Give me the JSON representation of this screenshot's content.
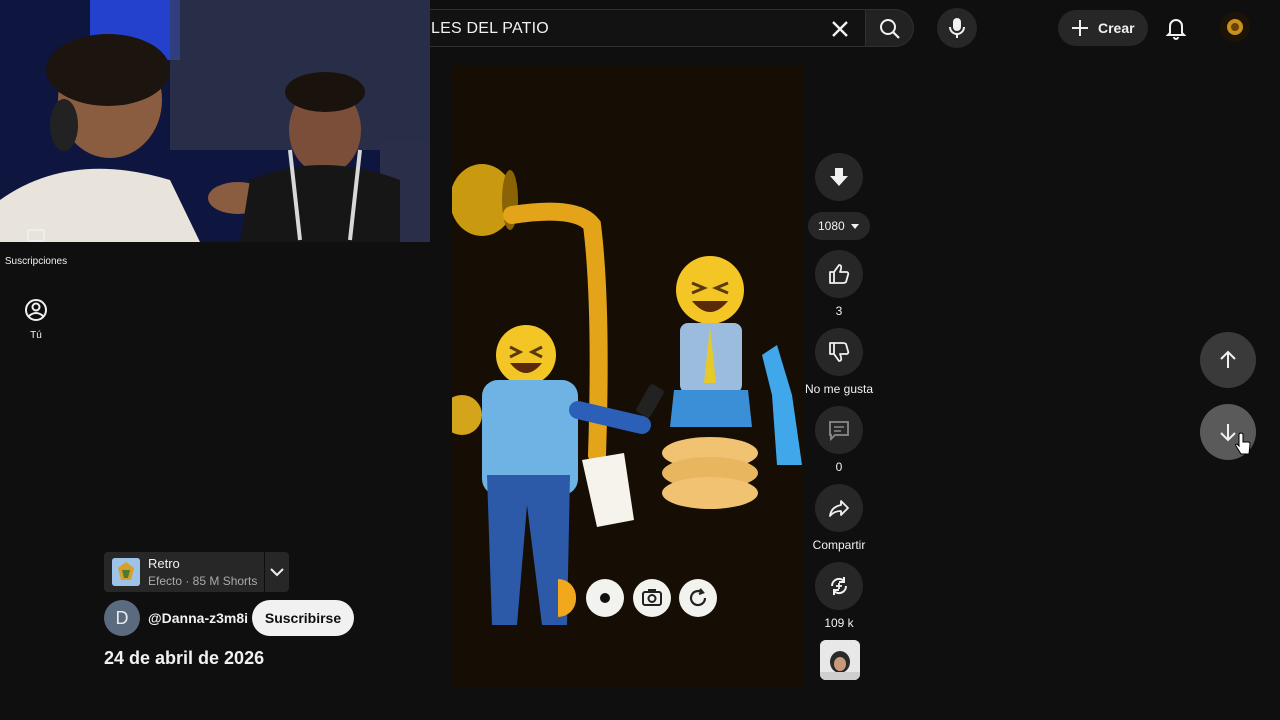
{
  "search": {
    "query": "LES DEL PATIO"
  },
  "header": {
    "create_label": "Crear"
  },
  "guide": {
    "subscriptions_label": "Suscripciones",
    "you_label": "Tú"
  },
  "player": {
    "quality": "1080",
    "likes": "3",
    "dislike_label": "No me gusta",
    "comments": "0",
    "share_label": "Compartir",
    "remix_count": "109 k"
  },
  "info": {
    "effect_name": "Retro",
    "effect_meta": "Efecto · 85 M Shorts",
    "channel_initial": "D",
    "channel_handle": "@Danna-z3m8i",
    "subscribe_label": "Suscribirse",
    "date": "24 de abril de 2026"
  },
  "icons": {
    "clear": "close-icon",
    "search": "search-icon",
    "mic": "mic-icon",
    "create": "plus-icon",
    "notifications": "bell-icon",
    "download": "download-icon",
    "like": "thumbs-up-icon",
    "dislike": "thumbs-down-icon",
    "comments": "comment-icon",
    "share": "share-icon",
    "remix": "remix-icon",
    "prev": "arrow-up-icon",
    "next": "arrow-down-icon"
  },
  "colors": {
    "background": "#0f0f0f",
    "chip": "#272727",
    "subscribe_bg": "#f1f1f1"
  }
}
